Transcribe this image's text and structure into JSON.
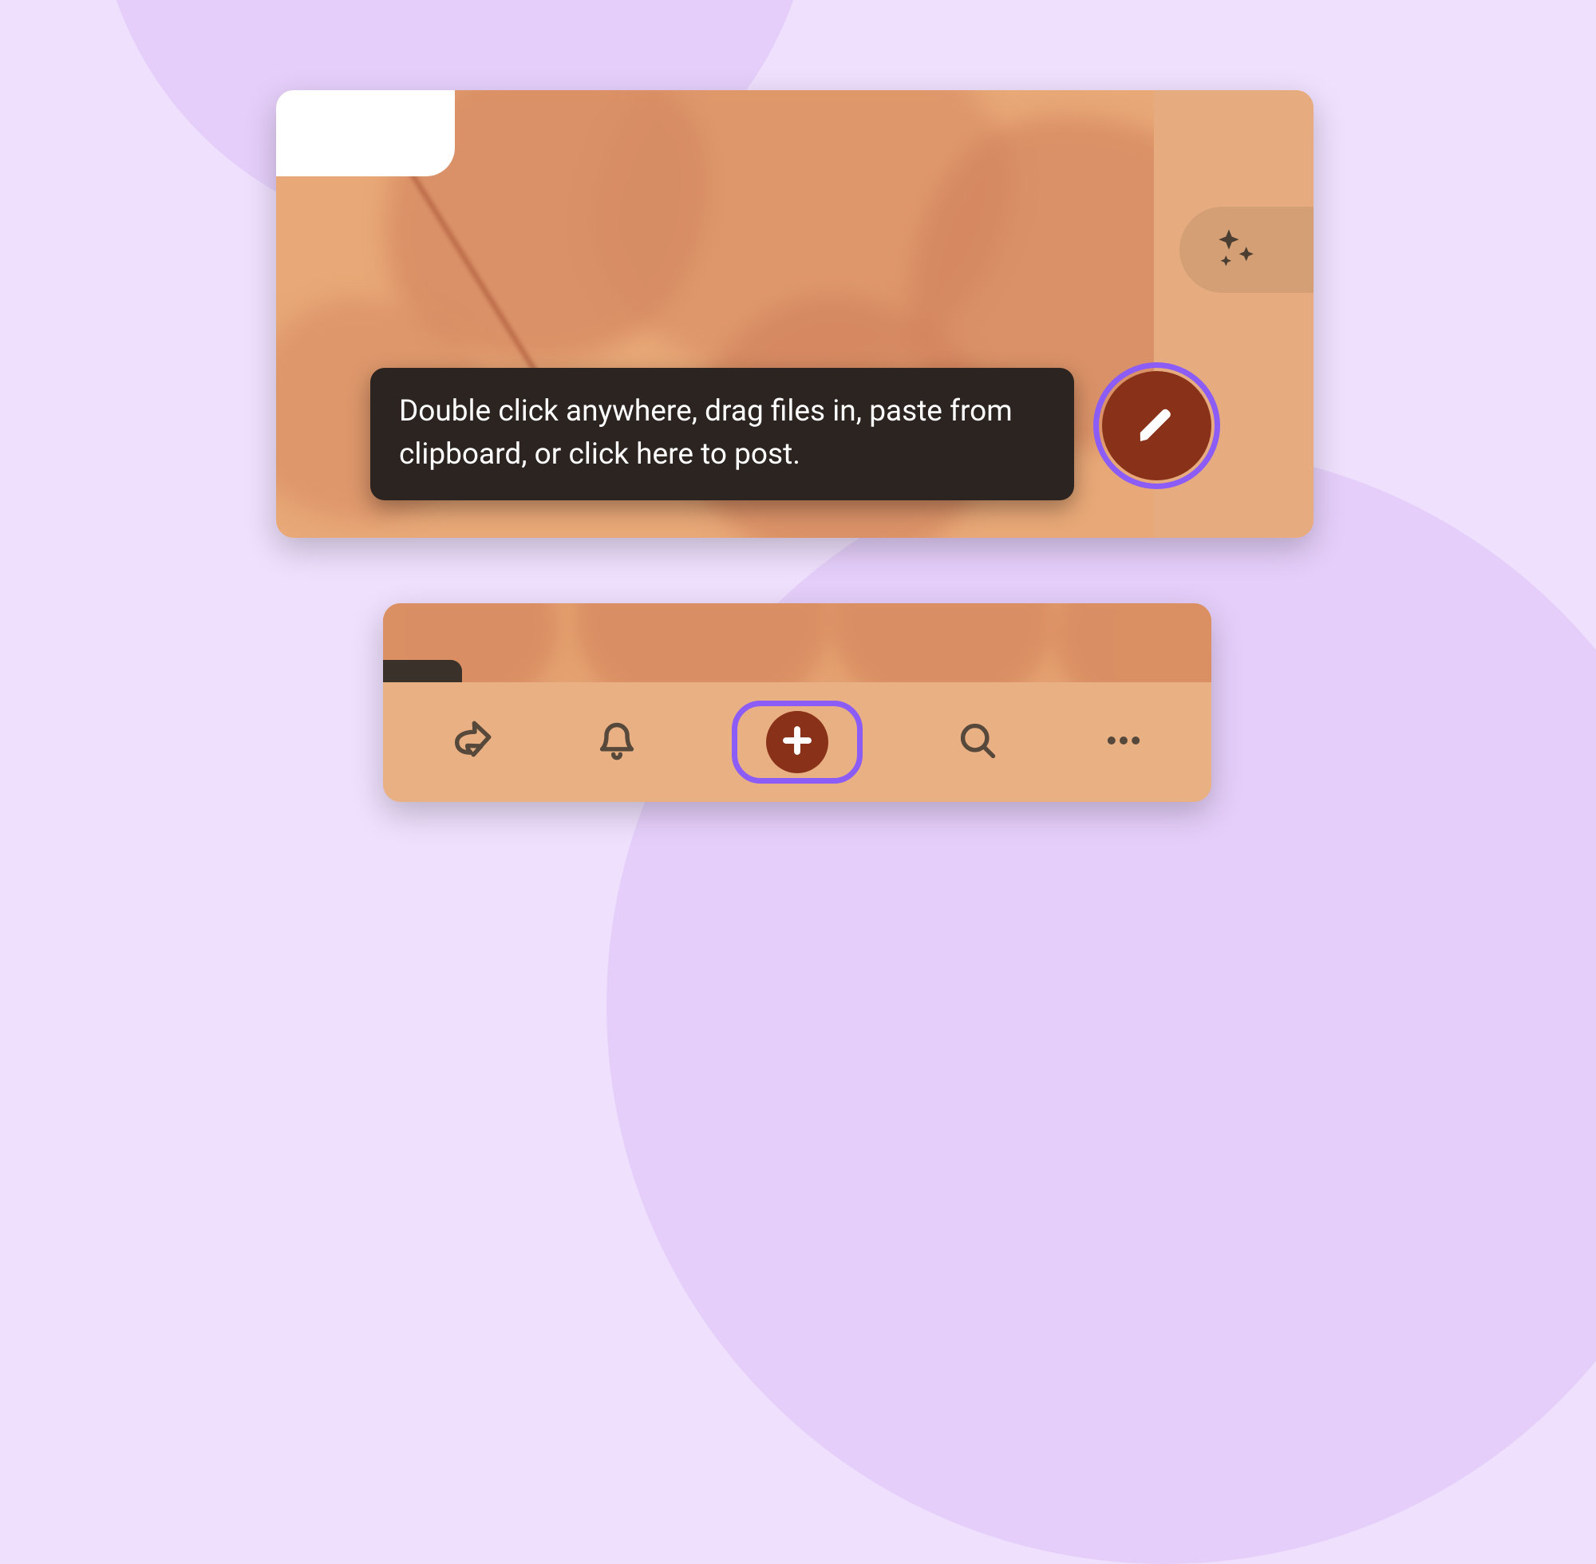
{
  "tooltip": {
    "text": "Double click anywhere, drag files in, paste from clipboard, or click here to post."
  },
  "icons": {
    "sparkle": "sparkle-icon",
    "compose": "pencil-icon",
    "share": "share-icon",
    "bell": "bell-icon",
    "add": "plus-icon",
    "search": "search-icon",
    "more": "more-icon"
  },
  "colors": {
    "accent_purple": "#8b5cf6",
    "action_fill": "#8a3219",
    "background_lavender": "#efe0fd",
    "background_circle": "#e5cffa",
    "canvas_peach": "#e8a877",
    "tooltip_bg": "#2b2421"
  }
}
